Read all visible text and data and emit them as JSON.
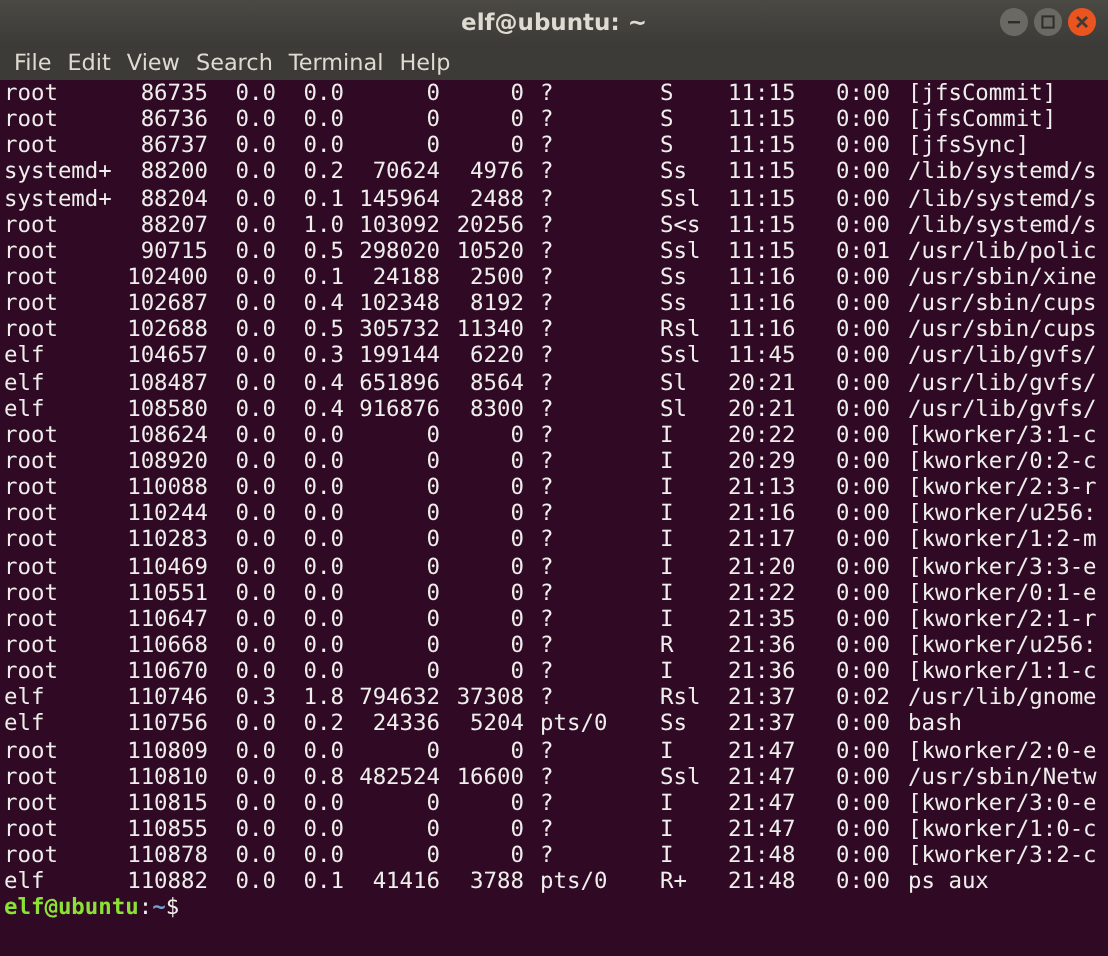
{
  "window": {
    "title": "elf@ubuntu: ~"
  },
  "menu": [
    "File",
    "Edit",
    "View",
    "Search",
    "Terminal",
    "Help"
  ],
  "rows": [
    [
      "root",
      "86735",
      "0.0",
      "0.0",
      "0",
      "0",
      "?",
      "S",
      "11:15",
      "0:00",
      "[jfsCommit]"
    ],
    [
      "root",
      "86736",
      "0.0",
      "0.0",
      "0",
      "0",
      "?",
      "S",
      "11:15",
      "0:00",
      "[jfsCommit]"
    ],
    [
      "root",
      "86737",
      "0.0",
      "0.0",
      "0",
      "0",
      "?",
      "S",
      "11:15",
      "0:00",
      "[jfsSync]"
    ],
    [
      "systemd+",
      "88200",
      "0.0",
      "0.2",
      "70624",
      "4976",
      "?",
      "Ss",
      "11:15",
      "0:00",
      "/lib/systemd/s"
    ],
    [
      "systemd+",
      "88204",
      "0.0",
      "0.1",
      "145964",
      "2488",
      "?",
      "Ssl",
      "11:15",
      "0:00",
      "/lib/systemd/s"
    ],
    [
      "root",
      "88207",
      "0.0",
      "1.0",
      "103092",
      "20256",
      "?",
      "S<s",
      "11:15",
      "0:00",
      "/lib/systemd/s"
    ],
    [
      "root",
      "90715",
      "0.0",
      "0.5",
      "298020",
      "10520",
      "?",
      "Ssl",
      "11:15",
      "0:01",
      "/usr/lib/polic"
    ],
    [
      "root",
      "102400",
      "0.0",
      "0.1",
      "24188",
      "2500",
      "?",
      "Ss",
      "11:16",
      "0:00",
      "/usr/sbin/xine"
    ],
    [
      "root",
      "102687",
      "0.0",
      "0.4",
      "102348",
      "8192",
      "?",
      "Ss",
      "11:16",
      "0:00",
      "/usr/sbin/cups"
    ],
    [
      "root",
      "102688",
      "0.0",
      "0.5",
      "305732",
      "11340",
      "?",
      "Rsl",
      "11:16",
      "0:00",
      "/usr/sbin/cups"
    ],
    [
      "elf",
      "104657",
      "0.0",
      "0.3",
      "199144",
      "6220",
      "?",
      "Ssl",
      "11:45",
      "0:00",
      "/usr/lib/gvfs/"
    ],
    [
      "elf",
      "108487",
      "0.0",
      "0.4",
      "651896",
      "8564",
      "?",
      "Sl",
      "20:21",
      "0:00",
      "/usr/lib/gvfs/"
    ],
    [
      "elf",
      "108580",
      "0.0",
      "0.4",
      "916876",
      "8300",
      "?",
      "Sl",
      "20:21",
      "0:00",
      "/usr/lib/gvfs/"
    ],
    [
      "root",
      "108624",
      "0.0",
      "0.0",
      "0",
      "0",
      "?",
      "I",
      "20:22",
      "0:00",
      "[kworker/3:1-c"
    ],
    [
      "root",
      "108920",
      "0.0",
      "0.0",
      "0",
      "0",
      "?",
      "I",
      "20:29",
      "0:00",
      "[kworker/0:2-c"
    ],
    [
      "root",
      "110088",
      "0.0",
      "0.0",
      "0",
      "0",
      "?",
      "I",
      "21:13",
      "0:00",
      "[kworker/2:3-r"
    ],
    [
      "root",
      "110244",
      "0.0",
      "0.0",
      "0",
      "0",
      "?",
      "I",
      "21:16",
      "0:00",
      "[kworker/u256:"
    ],
    [
      "root",
      "110283",
      "0.0",
      "0.0",
      "0",
      "0",
      "?",
      "I",
      "21:17",
      "0:00",
      "[kworker/1:2-m"
    ],
    [
      "root",
      "110469",
      "0.0",
      "0.0",
      "0",
      "0",
      "?",
      "I",
      "21:20",
      "0:00",
      "[kworker/3:3-e"
    ],
    [
      "root",
      "110551",
      "0.0",
      "0.0",
      "0",
      "0",
      "?",
      "I",
      "21:22",
      "0:00",
      "[kworker/0:1-e"
    ],
    [
      "root",
      "110647",
      "0.0",
      "0.0",
      "0",
      "0",
      "?",
      "I",
      "21:35",
      "0:00",
      "[kworker/2:1-r"
    ],
    [
      "root",
      "110668",
      "0.0",
      "0.0",
      "0",
      "0",
      "?",
      "R",
      "21:36",
      "0:00",
      "[kworker/u256:"
    ],
    [
      "root",
      "110670",
      "0.0",
      "0.0",
      "0",
      "0",
      "?",
      "I",
      "21:36",
      "0:00",
      "[kworker/1:1-c"
    ],
    [
      "elf",
      "110746",
      "0.3",
      "1.8",
      "794632",
      "37308",
      "?",
      "Rsl",
      "21:37",
      "0:02",
      "/usr/lib/gnome"
    ],
    [
      "elf",
      "110756",
      "0.0",
      "0.2",
      "24336",
      "5204",
      "pts/0",
      "Ss",
      "21:37",
      "0:00",
      "bash"
    ],
    [
      "root",
      "110809",
      "0.0",
      "0.0",
      "0",
      "0",
      "?",
      "I",
      "21:47",
      "0:00",
      "[kworker/2:0-e"
    ],
    [
      "root",
      "110810",
      "0.0",
      "0.8",
      "482524",
      "16600",
      "?",
      "Ssl",
      "21:47",
      "0:00",
      "/usr/sbin/Netw"
    ],
    [
      "root",
      "110815",
      "0.0",
      "0.0",
      "0",
      "0",
      "?",
      "I",
      "21:47",
      "0:00",
      "[kworker/3:0-e"
    ],
    [
      "root",
      "110855",
      "0.0",
      "0.0",
      "0",
      "0",
      "?",
      "I",
      "21:47",
      "0:00",
      "[kworker/1:0-c"
    ],
    [
      "root",
      "110878",
      "0.0",
      "0.0",
      "0",
      "0",
      "?",
      "I",
      "21:48",
      "0:00",
      "[kworker/3:2-c"
    ],
    [
      "elf",
      "110882",
      "0.0",
      "0.1",
      "41416",
      "3788",
      "pts/0",
      "R+",
      "21:48",
      "0:00",
      "ps aux"
    ]
  ],
  "prompt": {
    "user_host": "elf@ubuntu",
    "separator": ":",
    "path": "~",
    "symbol": "$"
  }
}
